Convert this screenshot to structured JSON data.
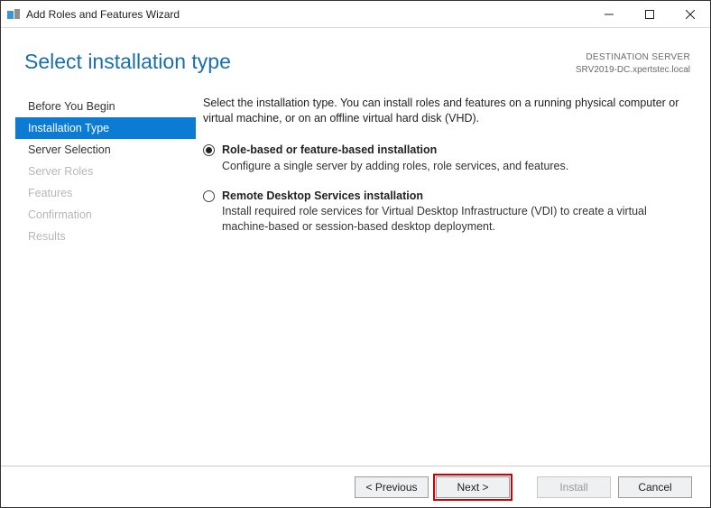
{
  "window": {
    "title": "Add Roles and Features Wizard"
  },
  "header": {
    "page_title": "Select installation type",
    "dest_label": "DESTINATION SERVER",
    "dest_name": "SRV2019-DC.xpertstec.local"
  },
  "sidebar": {
    "items": [
      {
        "label": "Before You Begin",
        "state": "normal"
      },
      {
        "label": "Installation Type",
        "state": "active"
      },
      {
        "label": "Server Selection",
        "state": "normal"
      },
      {
        "label": "Server Roles",
        "state": "disabled"
      },
      {
        "label": "Features",
        "state": "disabled"
      },
      {
        "label": "Confirmation",
        "state": "disabled"
      },
      {
        "label": "Results",
        "state": "disabled"
      }
    ]
  },
  "main": {
    "intro": "Select the installation type. You can install roles and features on a running physical computer or virtual machine, or on an offline virtual hard disk (VHD).",
    "options": [
      {
        "title": "Role-based or feature-based installation",
        "desc": "Configure a single server by adding roles, role services, and features.",
        "selected": true
      },
      {
        "title": "Remote Desktop Services installation",
        "desc": "Install required role services for Virtual Desktop Infrastructure (VDI) to create a virtual machine-based or session-based desktop deployment.",
        "selected": false
      }
    ]
  },
  "footer": {
    "previous": "< Previous",
    "next": "Next >",
    "install": "Install",
    "cancel": "Cancel"
  }
}
